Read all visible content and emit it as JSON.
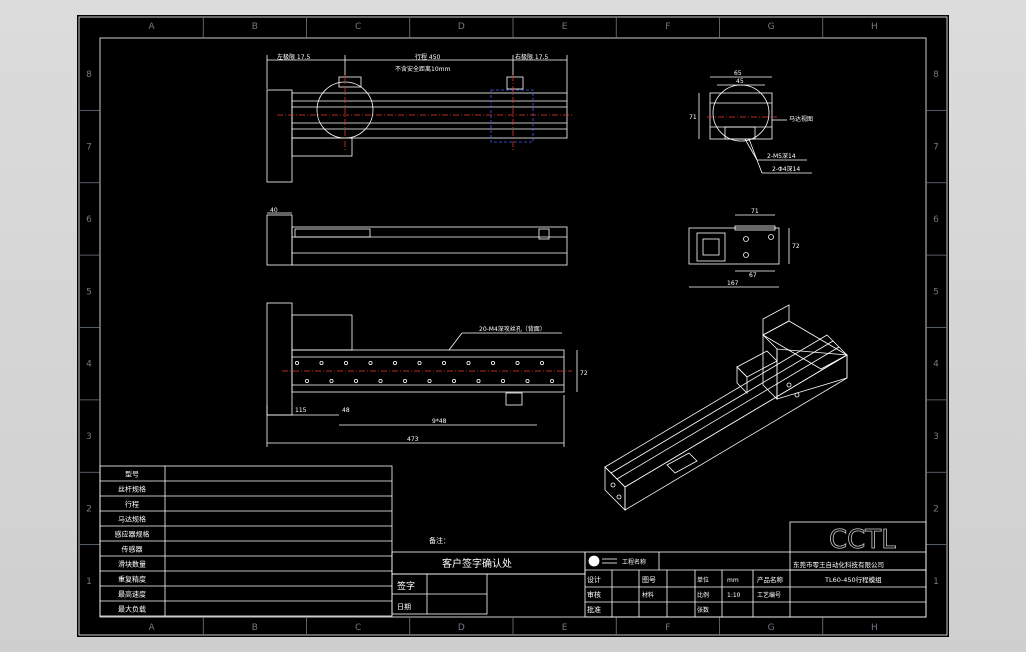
{
  "colors": {
    "sheet_bg": "#000000",
    "line": "#ffffff",
    "grid_label": "#6f7a85",
    "center_line": "#e8342a",
    "hidden_line": "#4a58ff",
    "logo": "#c8c8c8"
  },
  "grid": {
    "columns": [
      "A",
      "B",
      "C",
      "D",
      "E",
      "F",
      "G",
      "H"
    ],
    "rows": [
      "8",
      "7",
      "6",
      "5",
      "4",
      "3",
      "2",
      "1"
    ]
  },
  "front_view": {
    "dim_left": "左极限 17.5",
    "dim_middle": "行程 450",
    "dim_right": "右极限 17.5",
    "dim_sub": "不含安全距离10mm"
  },
  "side_view": {
    "dim_overall": "40"
  },
  "bottom_view": {
    "hole_note": "20-M4深攻丝孔（背面）",
    "dim_a": "115",
    "dim_b": "48",
    "dim_c": "9*48",
    "dim_total": "473",
    "dim_height": "72"
  },
  "end_view": {
    "dim_top1": "65",
    "dim_top2": "45",
    "dim_left": "71",
    "note_motor": "马达视图",
    "note_hole1": "2-M5深14",
    "note_hole2": "2-Φ4深14"
  },
  "end_view_2": {
    "dim_top": "71",
    "dim_bottom": "67",
    "dim_total": "167",
    "dim_right": "72"
  },
  "left_table": {
    "rows": [
      "型号",
      "丝杆规格",
      "行程",
      "马达规格",
      "感应器规格",
      "传感器",
      "滑块数量",
      "重复精度",
      "最高速度",
      "最大负载"
    ]
  },
  "signature_block": {
    "remark_label": "备注：",
    "title": "客户签字确认处",
    "sign_label": "签字",
    "date_label": "日期"
  },
  "title_block": {
    "logo_text": "CCTL",
    "company": "东莞市零王自动化科技有限公司",
    "product_name": "TL60-450行程模组",
    "project_label": "工程名称",
    "design_label": "设计",
    "check_label": "审核",
    "approve_label": "批准",
    "drawing_no_label": "图号",
    "scale_label": "比例",
    "scale_value": "1:10",
    "unit_label": "单位",
    "unit_value": "mm",
    "sheet_label": "张数",
    "product_label": "产品名称",
    "craft_label": "工艺编号",
    "material_label": "材料"
  }
}
